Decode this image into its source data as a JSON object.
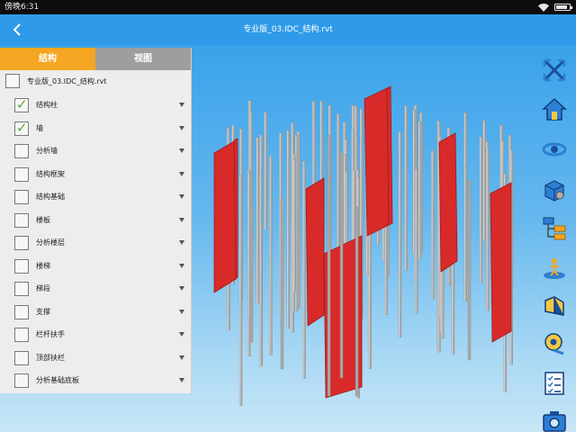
{
  "status_bar": {
    "time": "傍晚6:31",
    "icons": [
      "wifi-icon",
      "battery-icon"
    ],
    "battery_level": 0.85
  },
  "header": {
    "title": "专业版_03.IDC_结构.rvt",
    "back_icon": "chevron-left-icon"
  },
  "panel": {
    "tabs": [
      {
        "label": "结构",
        "active": true
      },
      {
        "label": "视图",
        "active": false
      }
    ],
    "file": {
      "label": "专业版_03.IDC_结构.rvt",
      "checked": false
    },
    "categories": [
      {
        "label": "结构柱",
        "checked": true
      },
      {
        "label": "墙",
        "checked": true
      },
      {
        "label": "分析墙",
        "checked": false
      },
      {
        "label": "结构框架",
        "checked": false
      },
      {
        "label": "结构基础",
        "checked": false
      },
      {
        "label": "楼板",
        "checked": false
      },
      {
        "label": "分析楼层",
        "checked": false
      },
      {
        "label": "楼梯",
        "checked": false
      },
      {
        "label": "梯段",
        "checked": false
      },
      {
        "label": "支撑",
        "checked": false
      },
      {
        "label": "栏杆扶手",
        "checked": false
      },
      {
        "label": "顶部扶栏",
        "checked": false
      },
      {
        "label": "分析基础底板",
        "checked": false
      }
    ]
  },
  "toolbar": {
    "tools": [
      "zoom-extents-icon",
      "home-view-icon",
      "orbit-icon",
      "section-box-icon",
      "model-tree-icon",
      "walk-mode-icon",
      "measure-icon",
      "tape-measure-icon",
      "properties-list-icon",
      "camera-icon"
    ]
  },
  "colors": {
    "accent": "#f5a623",
    "header_blue": "#2f9be8",
    "wall_red": "#d92a2a",
    "column_gray": "#a8a8a8",
    "check_green": "#5aa532"
  }
}
